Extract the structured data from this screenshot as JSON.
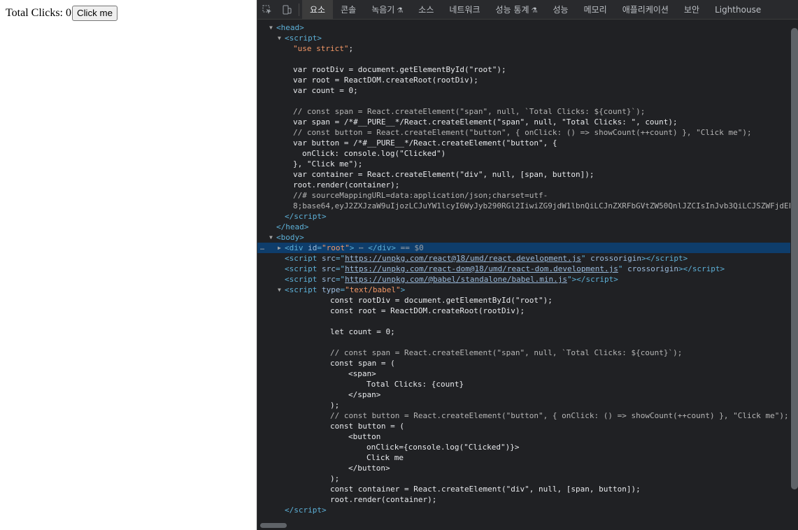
{
  "preview": {
    "text": "Total Clicks: 0",
    "button_label": "Click me"
  },
  "devtools": {
    "tabs": [
      "요소",
      "콘솔",
      "녹음기",
      "소스",
      "네트워크",
      "성능 통계",
      "성능",
      "메모리",
      "애플리케이션",
      "보안",
      "Lighthouse"
    ],
    "selected_marker": "== $0",
    "ellipsis": "…",
    "head_script": {
      "use_strict": "\"use strict\"",
      "root_div": "var rootDiv = document.getElementById(\"root\");",
      "root": "var root = ReactDOM.createRoot(rootDiv);",
      "count": "var count = 0;",
      "comment_span": "// const span = React.createElement(\"span\", null, `Total Clicks: ${count}`);",
      "span": "var span = /*#__PURE__*/React.createElement(\"span\", null, \"Total Clicks: \", count);",
      "comment_button": "// const button = React.createElement(\"button\", { onClick: () => showCount(++count) }, \"Click me\");",
      "button1": "var button = /*#__PURE__*/React.createElement(\"button\", {",
      "button2": "onClick: console.log(\"Clicked\")",
      "button3": "}, \"Click me\");",
      "container": "var container = React.createElement(\"div\", null, [span, button]);",
      "render": "root.render(container);",
      "sourcemap1": "//# sourceMappingURL=data:application/json;charset=utf-",
      "sourcemap2": "8;base64,eyJ2ZXJzaW9uIjozLCJuYW1lcyI6WyJyb290RGl2IiwiZG9jdW1lbnQiLCJnZXRFbGVtZW50QnlJZCIsInJvb3QiLCJSZWFjdEF"
    },
    "body_scripts": [
      "https://unpkg.com/react@18/umd/react.development.js",
      "https://unpkg.com/react-dom@18/umd/react-dom.development.js",
      "https://unpkg.com/@babel/standalone/babel.min.js"
    ],
    "babel_script": {
      "type": "text/babel",
      "root_div": "const rootDiv = document.getElementById(\"root\");",
      "root": "const root = ReactDOM.createRoot(rootDiv);",
      "count": "let count = 0;",
      "comment_span": "// const span = React.createElement(\"span\", null, `Total Clicks: ${count}`);",
      "span_open": "const span = (",
      "span_tag_open": "<span>",
      "span_text": "Total Clicks: {count}",
      "span_tag_close": "</span>",
      "close_paren": ");",
      "comment_button": "// const button = React.createElement(\"button\", { onClick: () => showCount(++count) }, \"Click me\");",
      "button_open": "const button = (",
      "button_tag_open": "<button",
      "onclick": "onClick={console.log(\"Clicked\")}>",
      "click_me": "Click me",
      "button_tag_close": "</button>",
      "container": "const container = React.createElement(\"div\", null, [span, button]);",
      "render": "root.render(container);"
    }
  }
}
